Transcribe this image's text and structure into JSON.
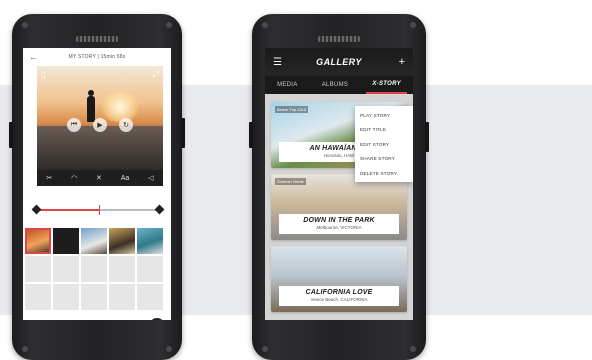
{
  "left_phone": {
    "header": {
      "back_icon": "arrow-left-icon",
      "title": "MY STORY | 15min 58s"
    },
    "video_controls": {
      "rewind_icon": "skip-back-icon",
      "play_icon": "play-icon",
      "replay_icon": "replay-icon",
      "stabilize_icon": "stabilize-icon",
      "fullscreen_icon": "fullscreen-icon"
    },
    "tools": [
      {
        "name": "scissors-icon",
        "glyph": "✂"
      },
      {
        "name": "speed-icon",
        "glyph": "◠"
      },
      {
        "name": "transition-icon",
        "glyph": "✕"
      },
      {
        "name": "text-icon",
        "glyph": "Aa"
      },
      {
        "name": "audio-icon",
        "glyph": "◁"
      }
    ],
    "fab_icon": "plus-icon",
    "fab_label": "+"
  },
  "right_phone": {
    "appbar": {
      "menu_icon": "hamburger-icon",
      "title": "GALLERY",
      "add_label": "+"
    },
    "tabs": [
      {
        "label": "MEDIA",
        "active": false
      },
      {
        "label": "ALBUMS",
        "active": false
      },
      {
        "label": "X-STORY",
        "active": true
      }
    ],
    "cards": [
      {
        "tag": "Beach Trip 2016",
        "title": "AN HAWAÏAN JO",
        "subtitle": "Honolulu, HAW"
      },
      {
        "tag": "Summer Break",
        "title": "DOWN IN THE PARK",
        "subtitle": "Melbourne, VICTORIA"
      },
      {
        "tag": "",
        "title": "CALIFORNIA LOVE",
        "subtitle": "Venice Beach, CALIFORNIA"
      }
    ],
    "context_menu": [
      {
        "label": "PLAY STORY"
      },
      {
        "label": "EDIT TITLE"
      },
      {
        "label": "EDIT STORY"
      },
      {
        "label": "SHARE STORY"
      },
      {
        "label": "DELETE STORY"
      }
    ]
  },
  "colors": {
    "accent": "#e24545",
    "dark": "#1f1f1f",
    "band": "#e8eaee"
  }
}
